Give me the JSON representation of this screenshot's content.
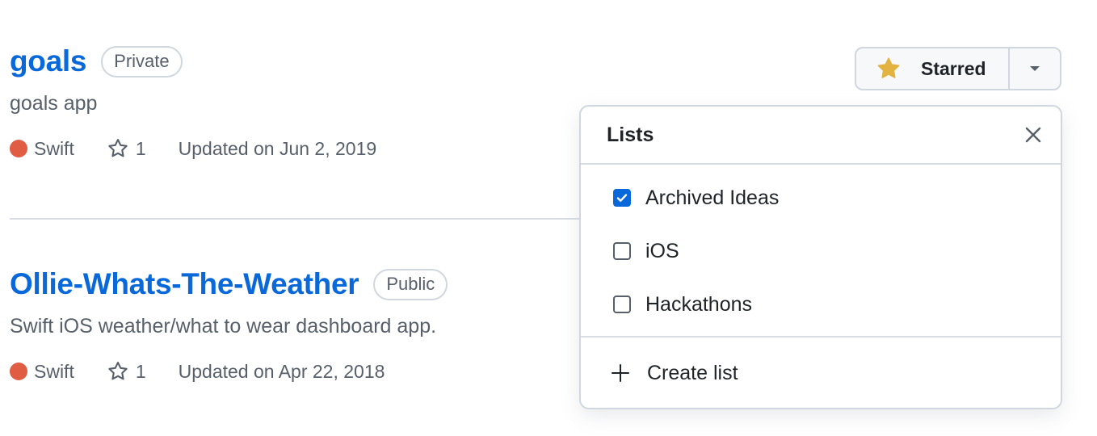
{
  "repos": [
    {
      "name": "goals",
      "visibility": "Private",
      "description": "goals app",
      "language": "Swift",
      "language_color": "#e05d44",
      "stars": "1",
      "updated": "Updated on Jun 2, 2019"
    },
    {
      "name": "Ollie-Whats-The-Weather",
      "visibility": "Public",
      "description": "Swift iOS weather/what to wear dashboard app.",
      "language": "Swift",
      "language_color": "#e05d44",
      "stars": "1",
      "updated": "Updated on Apr 22, 2018"
    }
  ],
  "star_button": {
    "label": "Starred",
    "icon": "star-filled-icon",
    "icon_color": "#e3b341",
    "caret_icon": "triangle-down-icon"
  },
  "lists_menu": {
    "title": "Lists",
    "close_icon": "x-icon",
    "options": [
      {
        "label": "Archived Ideas",
        "checked": true
      },
      {
        "label": "iOS",
        "checked": false
      },
      {
        "label": "Hackathons",
        "checked": false
      }
    ],
    "create_label": "Create list",
    "create_icon": "plus-icon"
  },
  "colors": {
    "link": "#0969da",
    "muted": "#57606a",
    "border": "#d0d7de",
    "checkbox_checked": "#0969da"
  }
}
